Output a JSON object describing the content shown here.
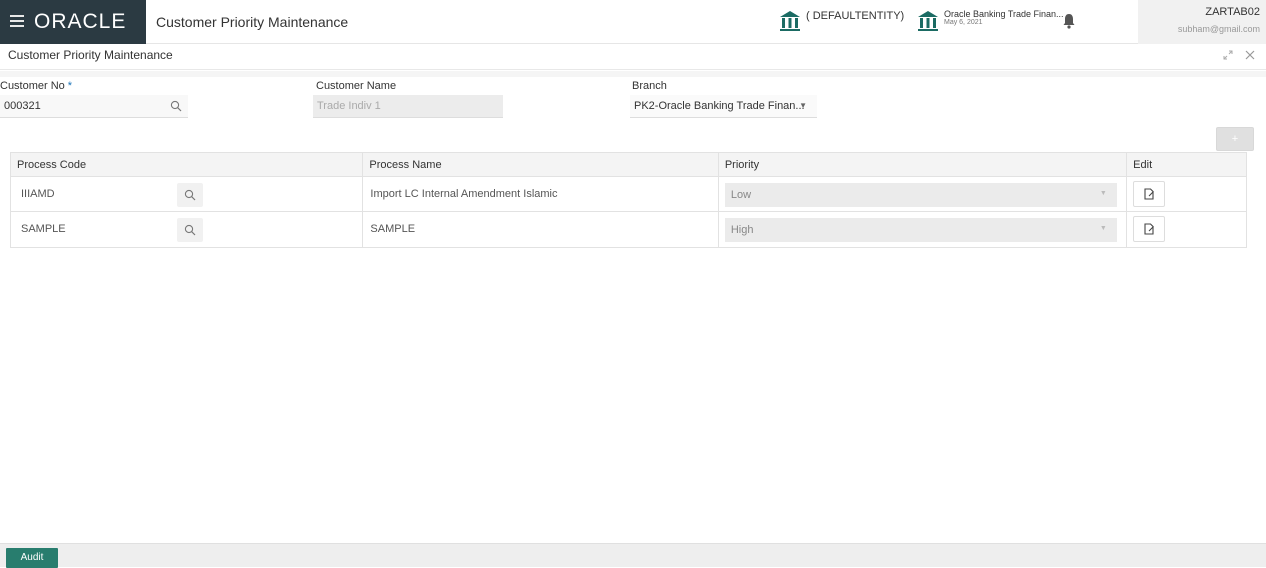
{
  "header": {
    "brand": "ORACLE",
    "app_title": "Customer Priority Maintenance",
    "entity1": "( DEFAULTENTITY)",
    "entity2_name": "Oracle Banking Trade Finan...",
    "entity2_date": "May 6, 2021",
    "user_name": "ZARTAB02",
    "user_email": "subham@gmail.com"
  },
  "subheader": {
    "title": "Customer Priority Maintenance"
  },
  "form": {
    "customer_no_label": "Customer No",
    "customer_no_required": "*",
    "customer_no_value": "000321",
    "customer_name_label": "Customer Name",
    "customer_name_value": "Trade Indiv 1",
    "branch_label": "Branch",
    "branch_value": "PK2-Oracle Banking Trade Finan..."
  },
  "add_label": "+",
  "table": {
    "headers": [
      "Process Code",
      "Process Name",
      "Priority",
      "Edit"
    ],
    "rows": [
      {
        "code": "IIIAMD",
        "name": "Import LC Internal Amendment Islamic",
        "priority": "Low"
      },
      {
        "code": "SAMPLE",
        "name": "SAMPLE",
        "priority": "High"
      }
    ]
  },
  "footer": {
    "audit_label": "Audit"
  },
  "colors": {
    "brand_bg": "#2b3a42",
    "audit_button": "#287d6e",
    "required_star": "#1a73b7"
  }
}
